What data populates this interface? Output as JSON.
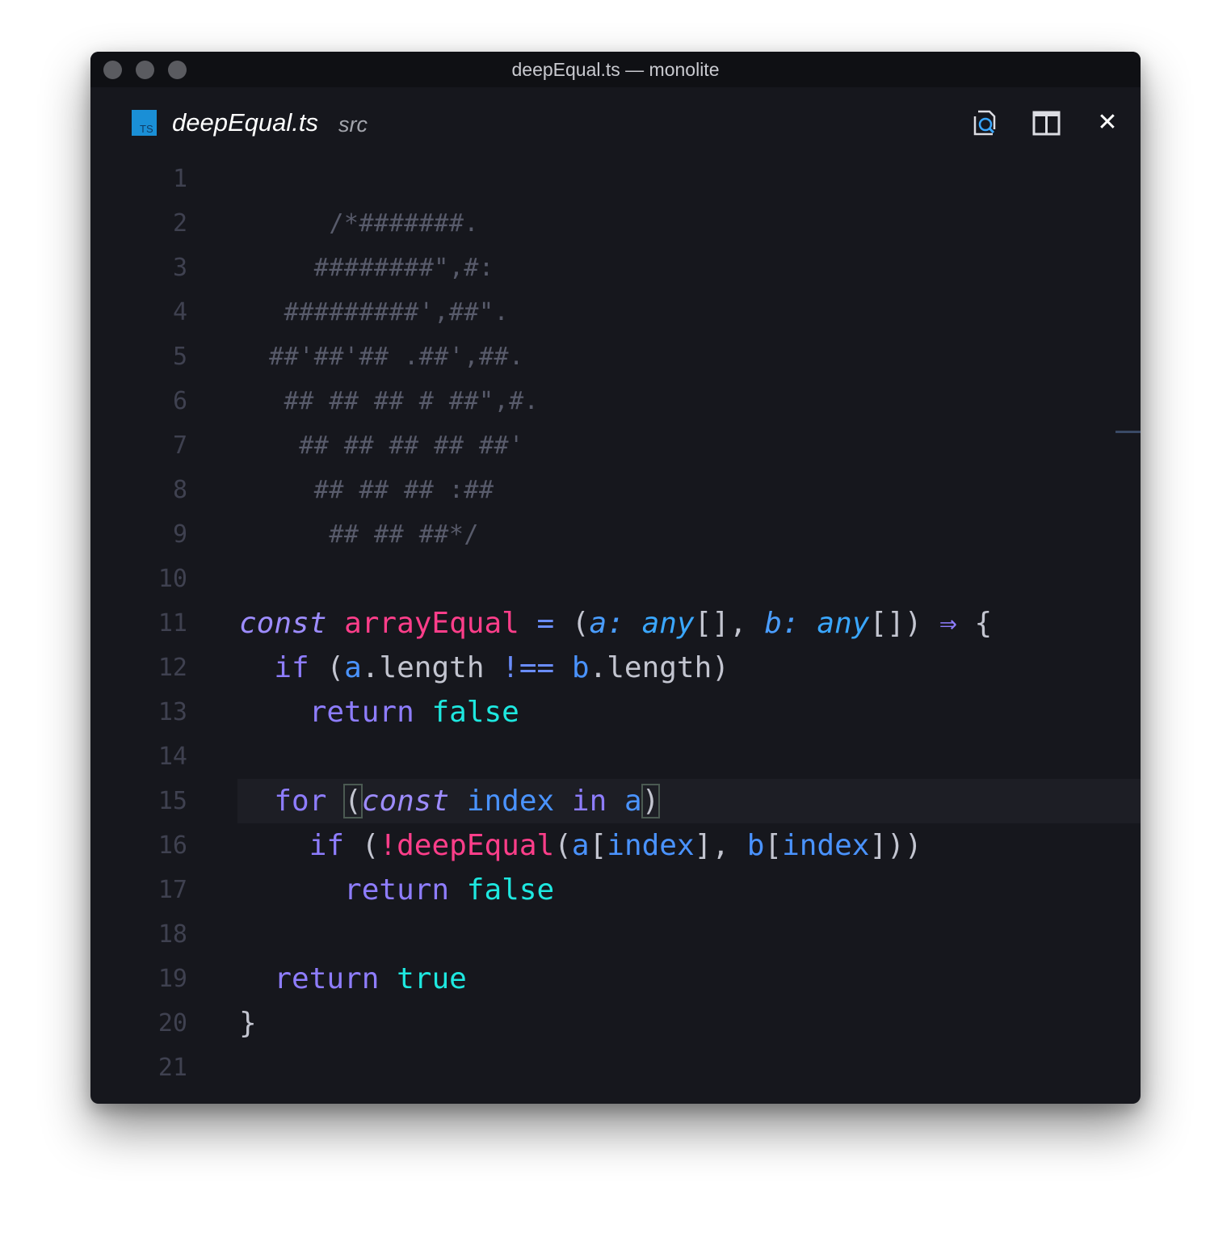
{
  "window": {
    "title": "deepEqual.ts — monolite",
    "traffic_colors": [
      "#5a5b60",
      "#5a5b60",
      "#5a5b60"
    ]
  },
  "tab": {
    "icon": "typescript-file-icon",
    "icon_text": "TS",
    "file_name": "deepEqual.ts",
    "directory": "src"
  },
  "toolbar": {
    "find_icon": "search-file-icon",
    "split_icon": "split-editor-icon",
    "close_icon": "close-icon",
    "close_glyph": "✕"
  },
  "editor": {
    "line_numbers": [
      "1",
      "2",
      "3",
      "4",
      "5",
      "6",
      "7",
      "8",
      "9",
      "10",
      "11",
      "12",
      "13",
      "14",
      "15",
      "16",
      "17",
      "18",
      "19",
      "20",
      "21"
    ],
    "ascii_art": [
      "",
      "      /*#######.",
      "     ########\",#:",
      "   #########',##\".",
      "  ##'##'## .##',##.",
      "   ## ## ## # ##\",#.",
      "    ## ## ## ## ##'",
      "     ## ## ## :##",
      "      ## ## ##*/"
    ],
    "tokens": {
      "const": "const",
      "arrayEqual": "arrayEqual",
      "eq": " = ",
      "lparen": "(",
      "a": "a",
      "colon": ":",
      "any": "any",
      "brackets": "[]",
      "comma": ", ",
      "b": "b",
      "rparen": ")",
      "arrow": " ⇒ ",
      "lbrace": "{",
      "if": "if",
      "a_length": "a",
      "dot_length": ".length",
      "neq": " !== ",
      "b_length": "b",
      "return": "return",
      "false": "false",
      "for": "for",
      "index": "index",
      "in": "in",
      "not": "!",
      "deepEqual": "deepEqual",
      "lbracket": "[",
      "rbracket": "]",
      "true": "true",
      "rbrace": "}"
    }
  },
  "theme": {
    "background": "#16171d",
    "keyword": "#8e7dff",
    "function": "#ff3e8a",
    "boolean": "#1ee8e0",
    "variable": "#4a93ff"
  }
}
